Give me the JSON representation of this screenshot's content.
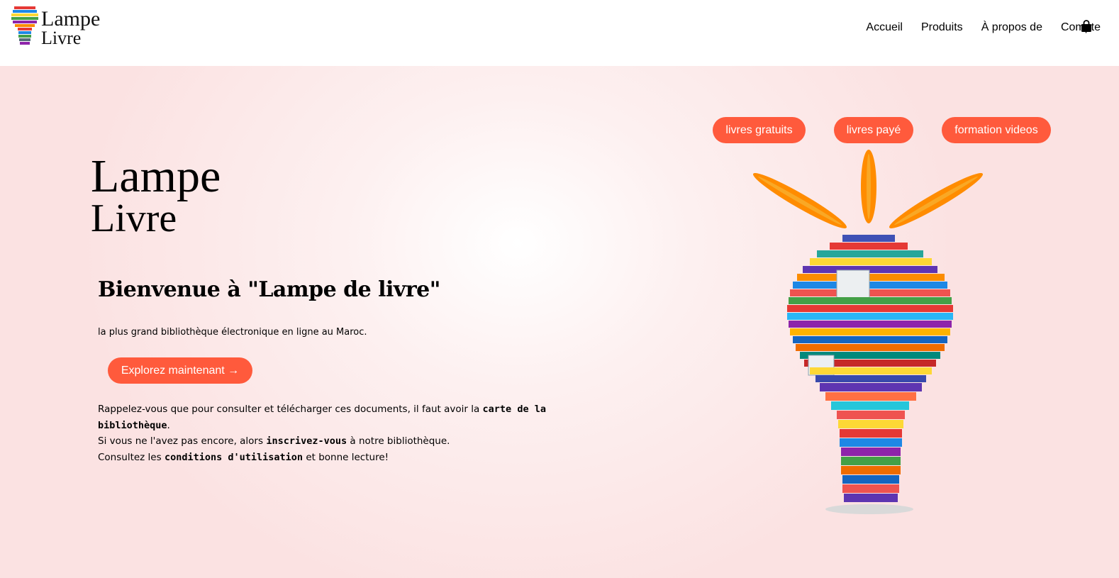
{
  "header": {
    "logo_text_line1": "Lampe",
    "logo_text_line2": "Livre",
    "nav": {
      "home": "Accueil",
      "products": "Produits",
      "about": "À propos de",
      "account": "Compte"
    },
    "cart_icon": "shopping-bag-icon"
  },
  "hero": {
    "logo_line1": "Lampe",
    "logo_line2": "Livre",
    "title": "Bienvenue à \"Lampe de livre\"",
    "tagline": "la plus grand bibliothèque électronique en ligne au Maroc.",
    "cta_label": "Explorez maintenant →",
    "info": {
      "line1_prefix": "Rappelez-vous que pour consulter et télécharger ces documents, il faut avoir la ",
      "line1_bold": "carte de la bibliothèque",
      "line1_suffix": ".",
      "line2_prefix": "Si vous ne l'avez pas encore, alors ",
      "line2_bold": "inscrivez-vous",
      "line2_suffix": " à notre bibliothèque.",
      "line3_prefix": "Consultez les ",
      "line3_bold": "conditions d'utilisation",
      "line3_suffix": " et bonne lecture!"
    },
    "categories": {
      "free_books": "livres gratuits",
      "paid_books": "livres payé",
      "video_training": "formation videos"
    }
  },
  "colors": {
    "accent": "#ff5a3c",
    "background_pink": "#fbe2e2",
    "ray_orange": "#ff8c00"
  }
}
